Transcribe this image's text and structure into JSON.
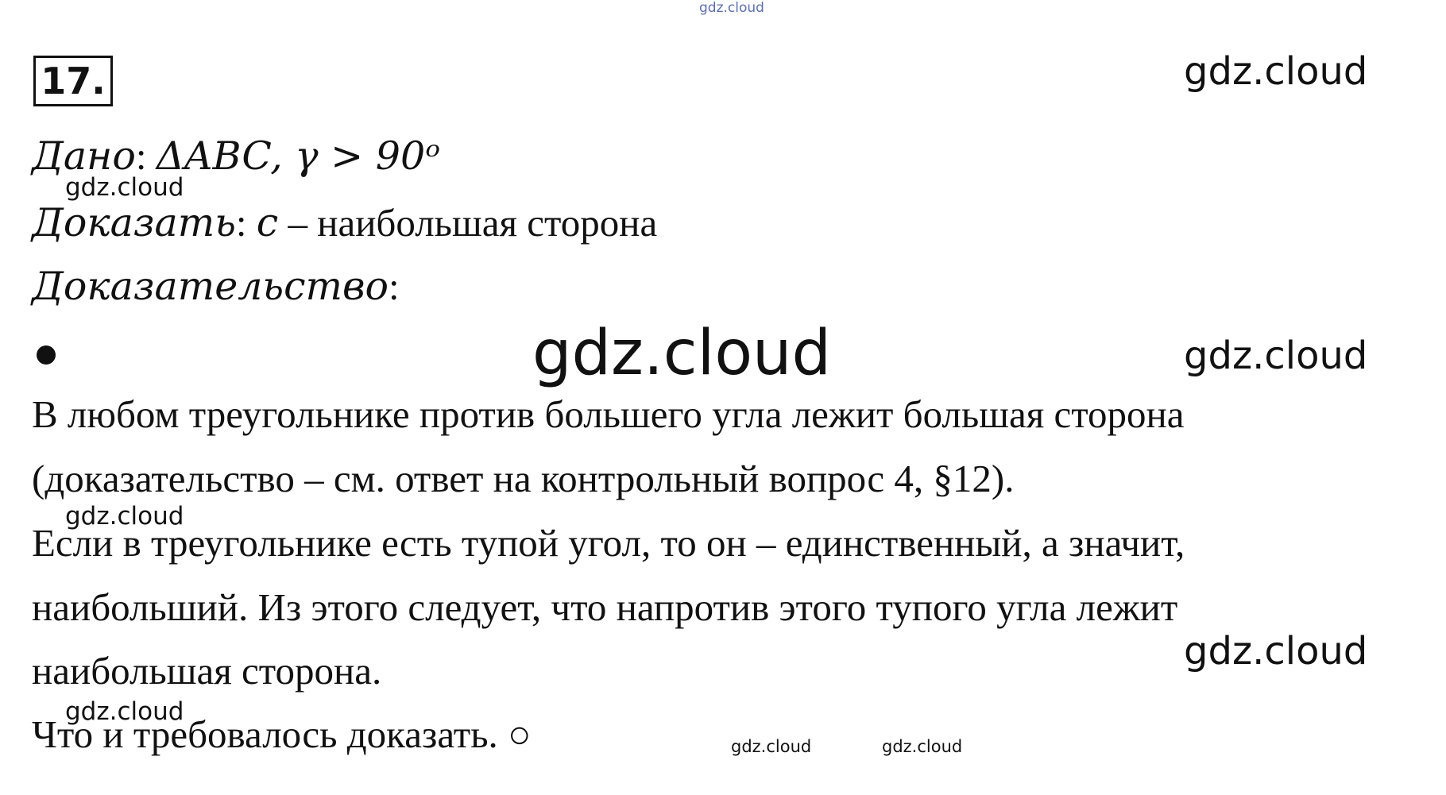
{
  "watermark": "gdz.cloud",
  "problem_number": "17.",
  "given": {
    "label": "Дано",
    "colon": ":",
    "formula": "ΔABC, γ > 90ᵒ"
  },
  "prove": {
    "label": "Доказать",
    "colon": ":",
    "variable": "c",
    "text": "– наибольшая сторона"
  },
  "proof": {
    "label": "Доказательство",
    "colon": ":"
  },
  "body": {
    "p1_line1": "В любом треугольнике против большего угла лежит большая сторона",
    "p1_line2": "(доказательство – см. ответ на контрольный вопрос 4, §12).",
    "p2_line1": "Если в треугольнике есть тупой угол, то он – единственный, а значит,",
    "p2_line2": "наибольший. Из этого следует, что напротив этого тупого угла лежит",
    "p2_line3": "наибольшая сторона.",
    "conclusion": "Что и требовалось доказать. ○"
  }
}
